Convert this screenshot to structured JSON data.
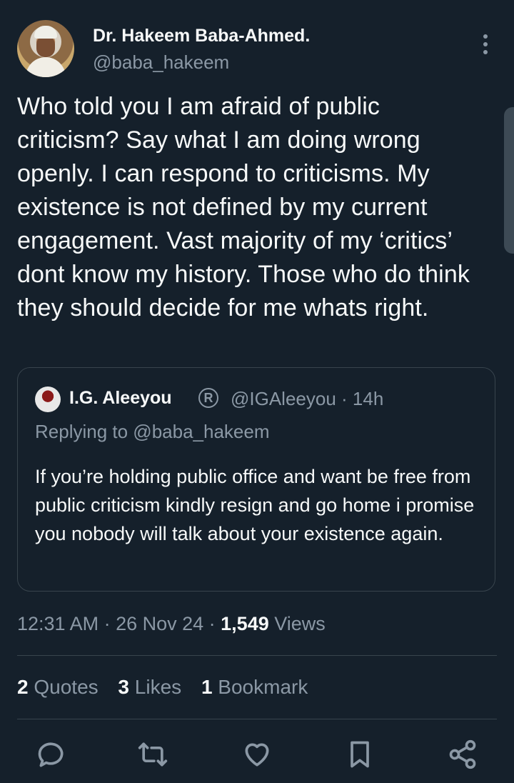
{
  "author": {
    "name": "Dr. Hakeem Baba-Ahmed.",
    "handle": "@baba_hakeem"
  },
  "tweet": {
    "text": "Who told you I am afraid of public criticism? Say what I am doing wrong openly. I can respond to criticisms. My existence is not defined by my current engagement. Vast majority of my ‘critics’ dont know my history. Those who do think they should decide for me whats right."
  },
  "quoted": {
    "name": "I.G. Aleeyou",
    "badge": "R",
    "handle": "@IGAleeyou · 14h",
    "replying_to": "Replying to @baba_hakeem",
    "text": "If you’re holding public office and want be free from public criticism kindly resign and go home i promise you nobody will talk about your existence again."
  },
  "meta": {
    "time_date": "12:31 AM · 26 Nov 24 · ",
    "views_count": "1,549",
    "views_label": "Views"
  },
  "stats": {
    "quotes_count": "2",
    "quotes_label": "Quotes",
    "likes_count": "3",
    "likes_label": "Likes",
    "bookmarks_count": "1",
    "bookmarks_label": "Bookmark"
  },
  "icons": [
    "more-icon",
    "reply-icon",
    "retweet-icon",
    "like-icon",
    "bookmark-icon",
    "share-icon"
  ],
  "colors": {
    "background": "#15202b",
    "text": "#f7f9f9",
    "secondary": "#8b98a5",
    "border": "#38444d"
  }
}
